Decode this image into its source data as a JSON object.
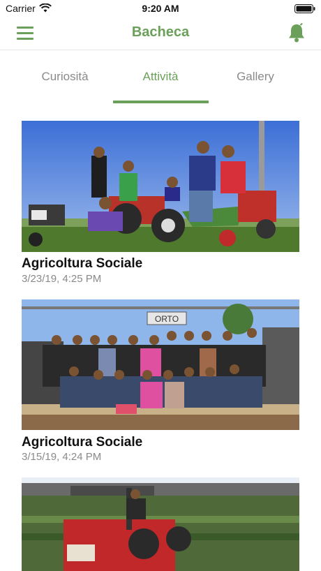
{
  "status_bar": {
    "carrier": "Carrier",
    "time": "9:20 AM"
  },
  "header": {
    "title": "Bacheca",
    "menu_icon": "hamburger-menu-icon",
    "notification_icon": "bell-icon"
  },
  "tabs": [
    {
      "label": "Curiosità",
      "active": false
    },
    {
      "label": "Attività",
      "active": true
    },
    {
      "label": "Gallery",
      "active": false
    }
  ],
  "posts": [
    {
      "title": "Agricoltura Sociale",
      "date": "3/23/19, 4:25 PM"
    },
    {
      "title": "Agricoltura Sociale",
      "date": "3/15/19, 4:24 PM",
      "sign_text": "ORTO"
    },
    {
      "title": "",
      "date": ""
    }
  ],
  "colors": {
    "accent": "#6aa05a",
    "muted_text": "#8a8a8a",
    "divider": "#e6e6e6"
  }
}
